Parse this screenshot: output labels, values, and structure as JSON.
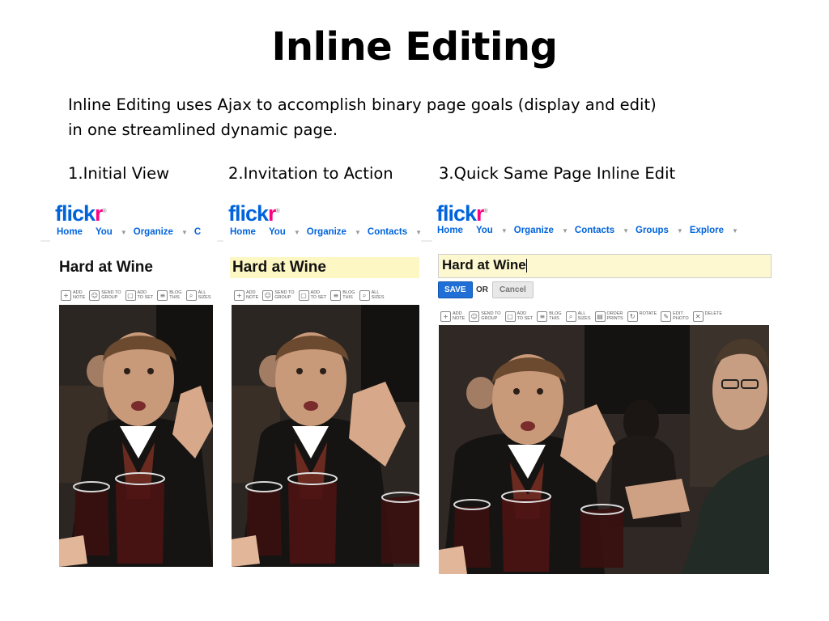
{
  "slide": {
    "title": "Inline Editing",
    "intro_line1": "Inline Editing uses Ajax to accomplish binary page goals (display and edit)",
    "intro_line2": "in one streamlined dynamic page.",
    "steps": [
      "1.Initial View",
      "2.Invitation to Action",
      "3.Quick Same Page Inline Edit"
    ]
  },
  "flickr": {
    "logo_left": "flick",
    "logo_right": "r",
    "logo_mark": "®",
    "nav_panel1": [
      "Home",
      "You",
      "Organize",
      "C"
    ],
    "nav_panel2": [
      "Home",
      "You",
      "Organize",
      "Contacts"
    ],
    "nav_panel3": [
      "Home",
      "You",
      "Organize",
      "Contacts",
      "Groups",
      "Explore"
    ],
    "photo_title": "Hard at Wine",
    "save_label": "SAVE",
    "or_label": "OR",
    "cancel_label": "Cancel",
    "toolbar_short": [
      {
        "icon": "add-note-icon",
        "line1": "ADD",
        "line2": "NOTE"
      },
      {
        "icon": "send-to-group-icon",
        "line1": "SEND TO",
        "line2": "GROUP"
      },
      {
        "icon": "add-to-set-icon",
        "line1": "ADD",
        "line2": "TO SET"
      },
      {
        "icon": "blog-this-icon",
        "line1": "BLOG",
        "line2": "THIS"
      },
      {
        "icon": "all-sizes-icon",
        "line1": "ALL",
        "line2": "SIZES"
      }
    ],
    "toolbar_full": [
      {
        "icon": "add-note-icon",
        "line1": "ADD",
        "line2": "NOTE"
      },
      {
        "icon": "send-to-group-icon",
        "line1": "SEND TO",
        "line2": "GROUP"
      },
      {
        "icon": "add-to-set-icon",
        "line1": "ADD",
        "line2": "TO SET"
      },
      {
        "icon": "blog-this-icon",
        "line1": "BLOG",
        "line2": "THIS"
      },
      {
        "icon": "all-sizes-icon",
        "line1": "ALL",
        "line2": "SIZES"
      },
      {
        "icon": "order-prints-icon",
        "line1": "ORDER",
        "line2": "PRINTS"
      },
      {
        "icon": "rotate-icon",
        "line1": "ROTATE",
        "line2": ""
      },
      {
        "icon": "edit-photo-icon",
        "line1": "EDIT",
        "line2": "PHOTO"
      },
      {
        "icon": "delete-icon",
        "line1": "DELETE",
        "line2": ""
      }
    ]
  },
  "colors": {
    "flickr_blue": "#0063dc",
    "flickr_pink": "#ff0084",
    "hover_yellow": "#fdf7c3",
    "save_blue": "#1f6fd6"
  }
}
